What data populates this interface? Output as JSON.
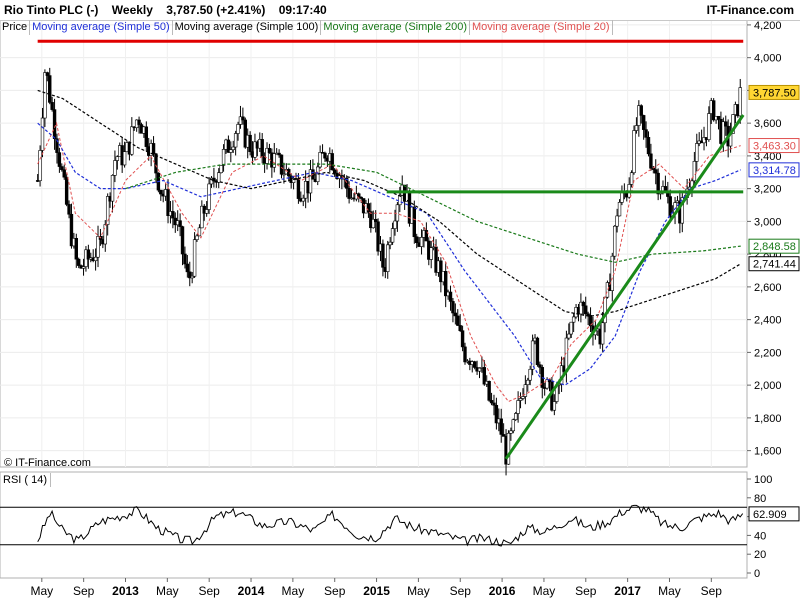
{
  "header": {
    "instrument": "Rio Tinto PLC (-)",
    "period": "Weekly",
    "price_change": "3,787.50 (+2.41%)",
    "time": "09:17:40",
    "brand": "IT-Finance.com"
  },
  "legend": {
    "price": "Price",
    "ma50": "Moving average (Simple 50)",
    "ma100": "Moving average (Simple 100)",
    "ma200": "Moving average (Simple 200)",
    "ma20": "Moving average (Simple 20)"
  },
  "copyright": "© IT-Finance.com",
  "rsi": {
    "label": "RSI ( 14)",
    "current": "62.909",
    "ticks": [
      "100",
      "80",
      "60",
      "40",
      "20",
      "0"
    ]
  },
  "colors": {
    "ma50": "#1f2fd8",
    "ma100": "#000000",
    "ma200": "#1a7a1a",
    "ma20": "#e05050",
    "resistance": "#e00000",
    "support": "#1a8a1a",
    "price_badge": "#ffd633"
  },
  "chart_data": {
    "type": "candlestick",
    "y_ticks": [
      "4,200",
      "4,000",
      "3,800",
      "3,600",
      "3,400",
      "3,200",
      "3,000",
      "2,800",
      "2,600",
      "2,400",
      "2,200",
      "2,000",
      "1,800",
      "1,600"
    ],
    "x_ticks": [
      "May",
      "Sep",
      "2013",
      "May",
      "Sep",
      "2014",
      "May",
      "Sep",
      "2015",
      "May",
      "Sep",
      "2016",
      "May",
      "Sep",
      "2017",
      "May",
      "Sep"
    ],
    "ylim": [
      1500,
      4230
    ],
    "last_price": "3,787.50",
    "ma_values": {
      "ma20": "3,463.30",
      "ma50": "3,314.78",
      "ma200": "2,848.58",
      "ma100": "2,741.44"
    },
    "price_path": [
      [
        2012.3,
        3250
      ],
      [
        2012.36,
        3950
      ],
      [
        2012.45,
        3500
      ],
      [
        2012.55,
        3000
      ],
      [
        2012.62,
        2700
      ],
      [
        2012.8,
        2850
      ],
      [
        2012.92,
        3400
      ],
      [
        2013.0,
        3400
      ],
      [
        2013.1,
        3650
      ],
      [
        2013.2,
        3450
      ],
      [
        2013.28,
        3200
      ],
      [
        2013.42,
        2950
      ],
      [
        2013.5,
        2620
      ],
      [
        2013.6,
        3000
      ],
      [
        2013.72,
        3300
      ],
      [
        2013.9,
        3600
      ],
      [
        2014.0,
        3450
      ],
      [
        2014.15,
        3400
      ],
      [
        2014.28,
        3300
      ],
      [
        2014.4,
        3200
      ],
      [
        2014.5,
        3250
      ],
      [
        2014.6,
        3450
      ],
      [
        2014.7,
        3300
      ],
      [
        2014.8,
        3150
      ],
      [
        2014.95,
        3050
      ],
      [
        2015.0,
        2900
      ],
      [
        2015.06,
        2700
      ],
      [
        2015.12,
        3000
      ],
      [
        2015.2,
        3250
      ],
      [
        2015.3,
        2950
      ],
      [
        2015.4,
        2850
      ],
      [
        2015.5,
        2700
      ],
      [
        2015.6,
        2450
      ],
      [
        2015.7,
        2200
      ],
      [
        2015.8,
        2150
      ],
      [
        2015.9,
        1900
      ],
      [
        2016.0,
        1700
      ],
      [
        2016.03,
        1580
      ],
      [
        2016.1,
        1750
      ],
      [
        2016.18,
        2050
      ],
      [
        2016.26,
        2250
      ],
      [
        2016.34,
        2000
      ],
      [
        2016.42,
        1880
      ],
      [
        2016.52,
        2250
      ],
      [
        2016.6,
        2500
      ],
      [
        2016.7,
        2400
      ],
      [
        2016.78,
        2300
      ],
      [
        2016.85,
        2600
      ],
      [
        2016.92,
        3100
      ],
      [
        2017.0,
        3200
      ],
      [
        2017.08,
        3650
      ],
      [
        2017.16,
        3450
      ],
      [
        2017.24,
        3250
      ],
      [
        2017.34,
        3100
      ],
      [
        2017.42,
        3050
      ],
      [
        2017.52,
        3350
      ],
      [
        2017.6,
        3500
      ],
      [
        2017.68,
        3700
      ],
      [
        2017.74,
        3550
      ],
      [
        2017.8,
        3500
      ],
      [
        2017.86,
        3650
      ],
      [
        2017.9,
        3787
      ]
    ],
    "ma20_path": [
      [
        2012.3,
        3350
      ],
      [
        2012.45,
        3600
      ],
      [
        2012.6,
        3050
      ],
      [
        2012.8,
        2900
      ],
      [
        2013.0,
        3250
      ],
      [
        2013.2,
        3400
      ],
      [
        2013.45,
        3050
      ],
      [
        2013.6,
        2900
      ],
      [
        2013.85,
        3300
      ],
      [
        2014.1,
        3400
      ],
      [
        2014.4,
        3250
      ],
      [
        2014.65,
        3350
      ],
      [
        2014.95,
        3050
      ],
      [
        2015.15,
        3050
      ],
      [
        2015.35,
        3000
      ],
      [
        2015.55,
        2750
      ],
      [
        2015.75,
        2300
      ],
      [
        2015.95,
        2000
      ],
      [
        2016.05,
        1900
      ],
      [
        2016.2,
        1950
      ],
      [
        2016.4,
        2050
      ],
      [
        2016.55,
        2250
      ],
      [
        2016.75,
        2400
      ],
      [
        2016.9,
        2700
      ],
      [
        2017.05,
        3250
      ],
      [
        2017.25,
        3350
      ],
      [
        2017.45,
        3200
      ],
      [
        2017.65,
        3400
      ],
      [
        2017.9,
        3463
      ]
    ],
    "ma50_path": [
      [
        2012.3,
        3600
      ],
      [
        2012.45,
        3500
      ],
      [
        2012.6,
        3300
      ],
      [
        2012.8,
        3200
      ],
      [
        2013.0,
        3200
      ],
      [
        2013.3,
        3250
      ],
      [
        2013.6,
        3150
      ],
      [
        2013.9,
        3200
      ],
      [
        2014.2,
        3250
      ],
      [
        2014.5,
        3300
      ],
      [
        2014.8,
        3250
      ],
      [
        2015.1,
        3150
      ],
      [
        2015.4,
        3050
      ],
      [
        2015.7,
        2700
      ],
      [
        2015.9,
        2500
      ],
      [
        2016.1,
        2300
      ],
      [
        2016.3,
        2050
      ],
      [
        2016.5,
        2000
      ],
      [
        2016.7,
        2100
      ],
      [
        2016.9,
        2300
      ],
      [
        2017.1,
        2700
      ],
      [
        2017.3,
        3000
      ],
      [
        2017.5,
        3200
      ],
      [
        2017.7,
        3250
      ],
      [
        2017.9,
        3315
      ]
    ],
    "ma100_path": [
      [
        2012.3,
        3800
      ],
      [
        2012.5,
        3750
      ],
      [
        2012.8,
        3600
      ],
      [
        2013.1,
        3450
      ],
      [
        2013.4,
        3350
      ],
      [
        2013.7,
        3250
      ],
      [
        2014.0,
        3200
      ],
      [
        2014.3,
        3250
      ],
      [
        2014.6,
        3300
      ],
      [
        2014.9,
        3250
      ],
      [
        2015.2,
        3150
      ],
      [
        2015.5,
        3000
      ],
      [
        2015.8,
        2800
      ],
      [
        2016.1,
        2650
      ],
      [
        2016.3,
        2550
      ],
      [
        2016.5,
        2450
      ],
      [
        2016.7,
        2420
      ],
      [
        2016.9,
        2450
      ],
      [
        2017.1,
        2500
      ],
      [
        2017.3,
        2550
      ],
      [
        2017.5,
        2600
      ],
      [
        2017.7,
        2650
      ],
      [
        2017.9,
        2741
      ]
    ],
    "ma200_path": [
      [
        2013.0,
        3200
      ],
      [
        2013.4,
        3300
      ],
      [
        2013.8,
        3350
      ],
      [
        2014.2,
        3350
      ],
      [
        2014.6,
        3350
      ],
      [
        2015.0,
        3300
      ],
      [
        2015.4,
        3150
      ],
      [
        2015.8,
        3000
      ],
      [
        2016.2,
        2900
      ],
      [
        2016.6,
        2800
      ],
      [
        2016.9,
        2750
      ],
      [
        2017.2,
        2800
      ],
      [
        2017.6,
        2820
      ],
      [
        2017.9,
        2849
      ]
    ],
    "resistance_line": {
      "price": 4100,
      "x_from": 2012.3,
      "x_to": 2017.92
    },
    "support_line": {
      "price": 3180,
      "x_from": 2015.08,
      "x_to": 2017.92
    },
    "trend_line": {
      "from": [
        2016.03,
        1550
      ],
      "to": [
        2017.92,
        3650
      ]
    },
    "rsi_path": [
      [
        2012.3,
        35
      ],
      [
        2012.4,
        64
      ],
      [
        2012.5,
        45
      ],
      [
        2012.62,
        34
      ],
      [
        2012.8,
        55
      ],
      [
        2013.0,
        62
      ],
      [
        2013.1,
        67
      ],
      [
        2013.25,
        48
      ],
      [
        2013.45,
        35
      ],
      [
        2013.55,
        34
      ],
      [
        2013.72,
        60
      ],
      [
        2013.9,
        65
      ],
      [
        2014.1,
        50
      ],
      [
        2014.3,
        55
      ],
      [
        2014.5,
        45
      ],
      [
        2014.65,
        62
      ],
      [
        2014.85,
        40
      ],
      [
        2015.0,
        38
      ],
      [
        2015.15,
        58
      ],
      [
        2015.3,
        48
      ],
      [
        2015.5,
        42
      ],
      [
        2015.7,
        34
      ],
      [
        2015.85,
        37
      ],
      [
        2016.0,
        33
      ],
      [
        2016.05,
        30
      ],
      [
        2016.2,
        48
      ],
      [
        2016.35,
        44
      ],
      [
        2016.55,
        58
      ],
      [
        2016.7,
        48
      ],
      [
        2016.85,
        55
      ],
      [
        2016.95,
        65
      ],
      [
        2017.05,
        70
      ],
      [
        2017.15,
        68
      ],
      [
        2017.28,
        52
      ],
      [
        2017.42,
        48
      ],
      [
        2017.56,
        58
      ],
      [
        2017.72,
        64
      ],
      [
        2017.82,
        55
      ],
      [
        2017.92,
        63
      ]
    ],
    "rsi_levels": [
      70,
      30
    ]
  }
}
